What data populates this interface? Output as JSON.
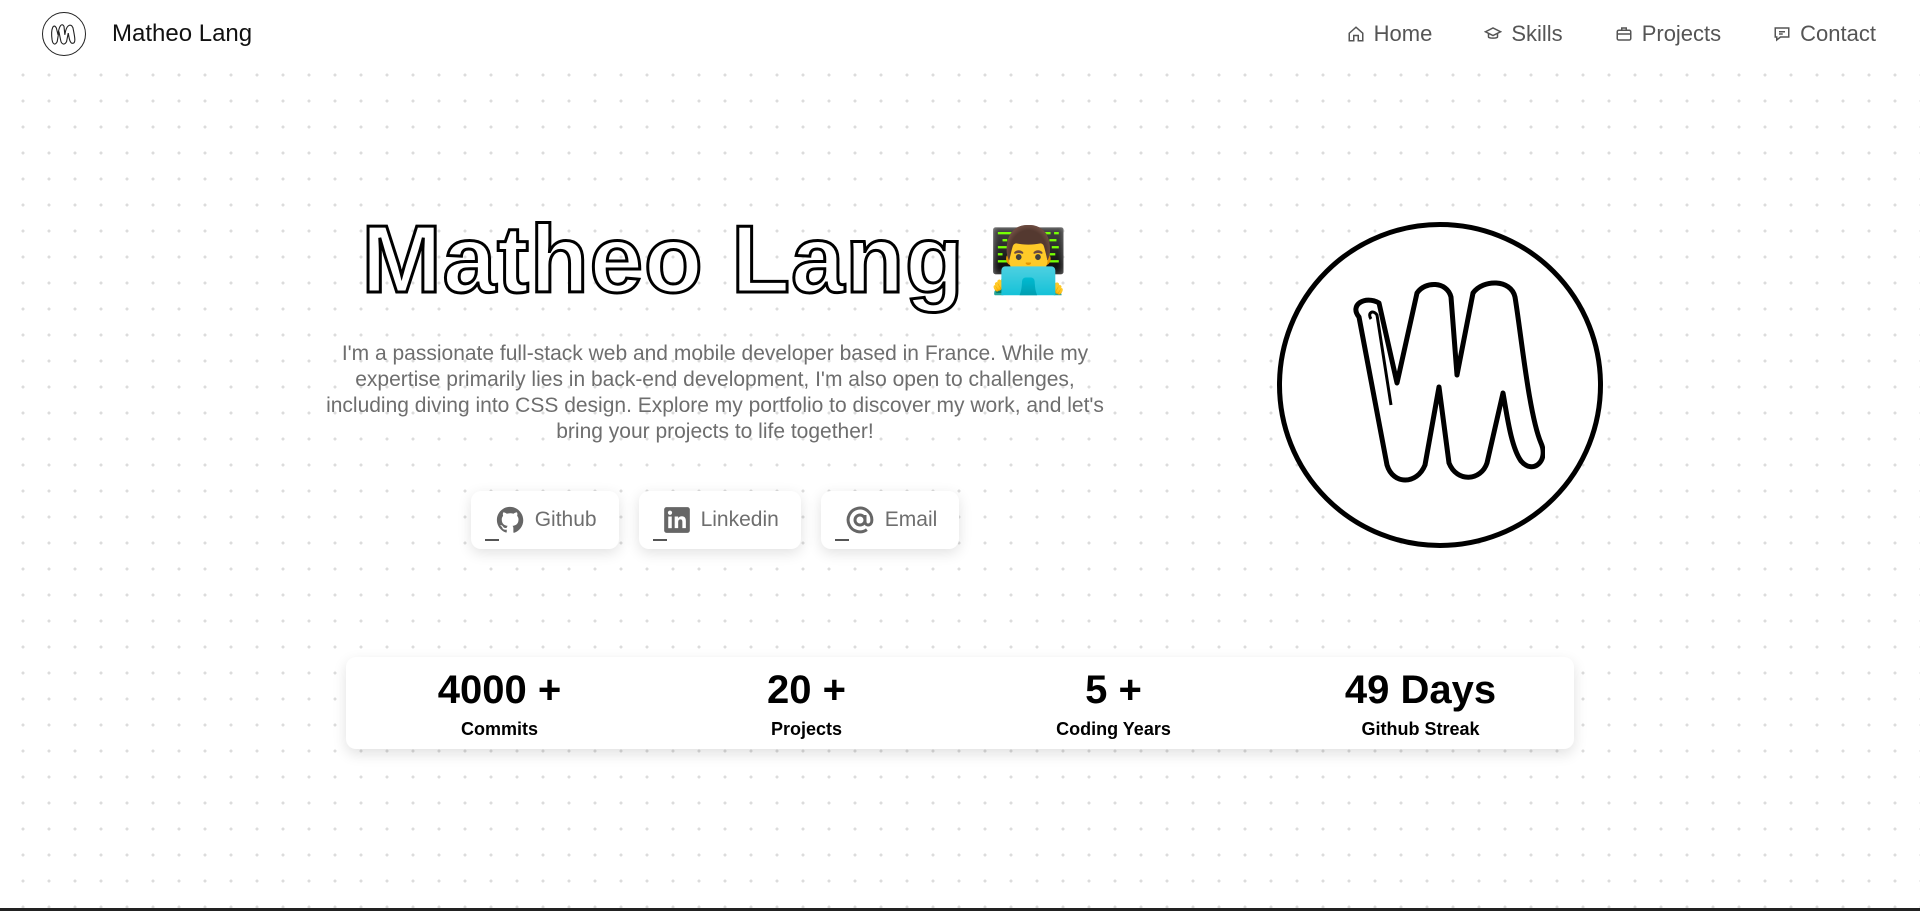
{
  "nav": {
    "brand": "Matheo Lang",
    "items": [
      {
        "label": "Home",
        "icon": "home-icon"
      },
      {
        "label": "Skills",
        "icon": "graduation-cap-icon"
      },
      {
        "label": "Projects",
        "icon": "briefcase-icon"
      },
      {
        "label": "Contact",
        "icon": "message-icon"
      }
    ]
  },
  "hero": {
    "title": "Matheo Lang",
    "emoji": "👨‍💻",
    "description": "I'm a passionate full-stack web and mobile developer based in France. While my expertise primarily lies in back-end development, I'm also open to challenges, including diving into CSS design. Explore my portfolio to discover my work, and let's bring your projects to life together!",
    "socials": [
      {
        "label": "Github",
        "icon": "github-icon"
      },
      {
        "label": "Linkedin",
        "icon": "linkedin-icon"
      },
      {
        "label": "Email",
        "icon": "at-sign-icon"
      }
    ]
  },
  "stats": [
    {
      "value": "4000 +",
      "label": "Commits"
    },
    {
      "value": "20 +",
      "label": "Projects"
    },
    {
      "value": "5 +",
      "label": "Coding Years"
    },
    {
      "value": "49 Days",
      "label": "Github Streak"
    }
  ],
  "colors": {
    "text_muted": "#6e6e6e",
    "dot_grid": "#dcdcdc",
    "outline": "#000000"
  }
}
